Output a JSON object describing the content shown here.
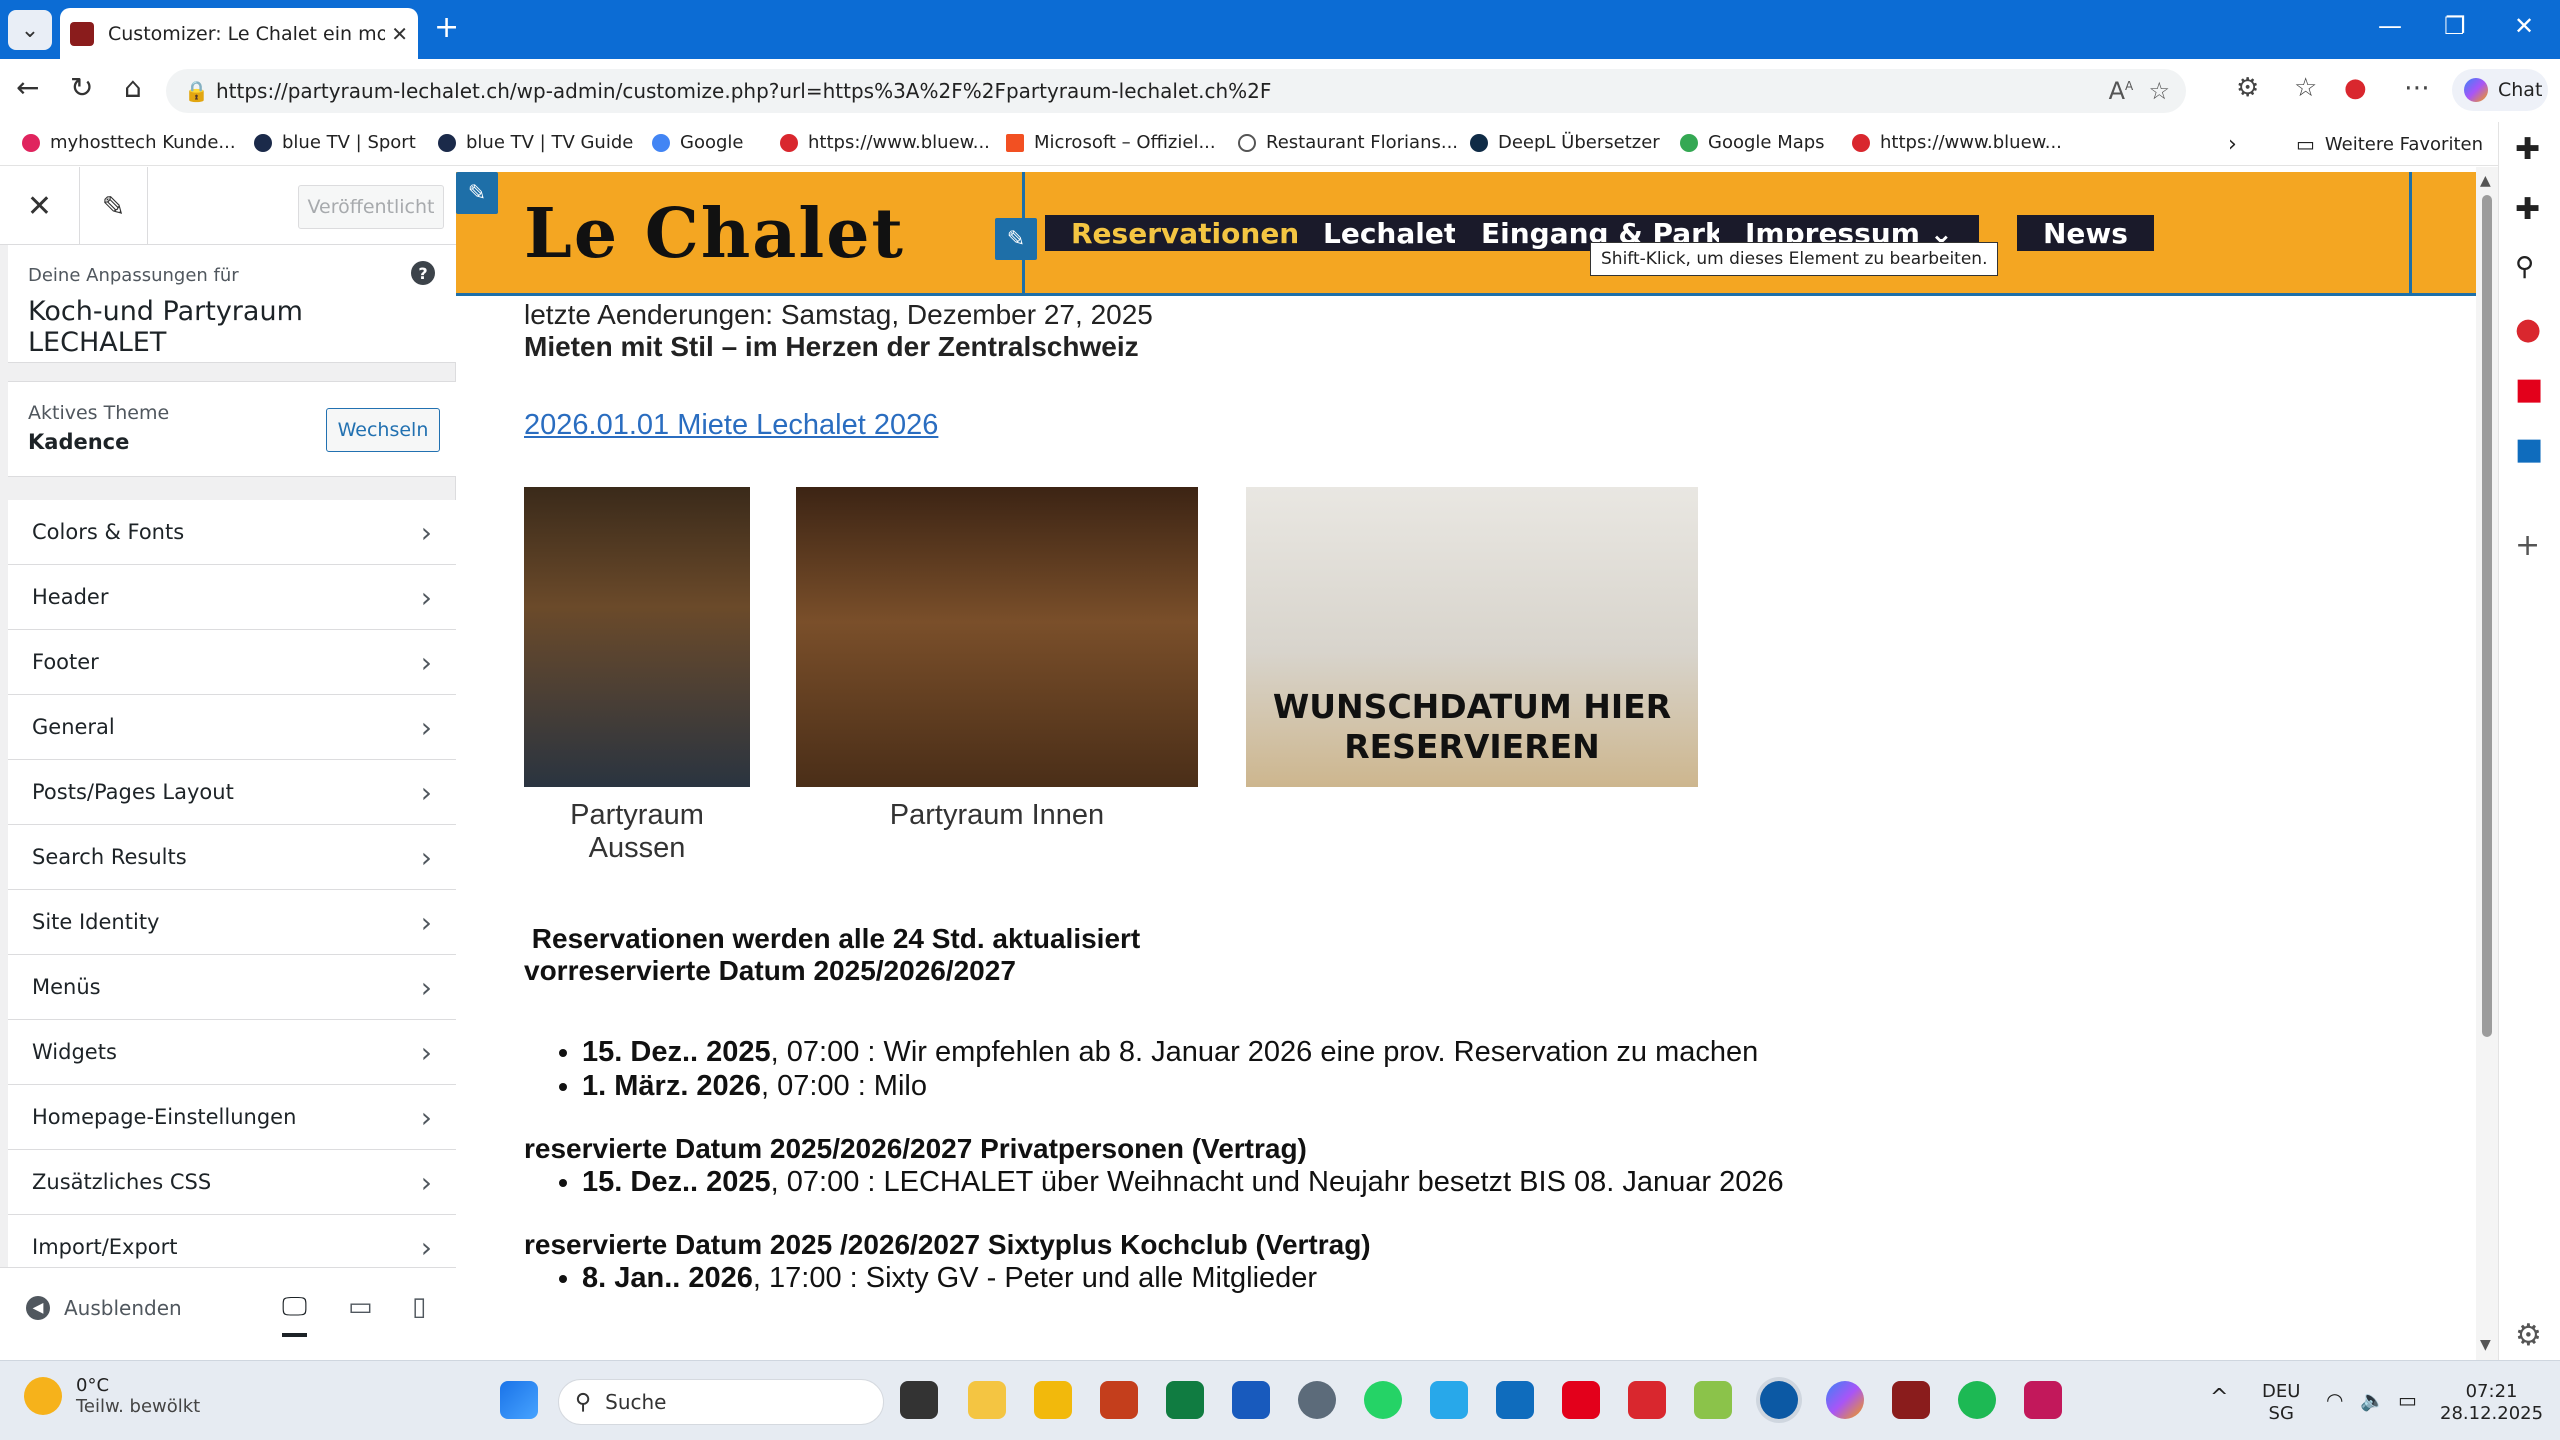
{
  "browser": {
    "tab_title": "Customizer: Le Chalet ein moderne",
    "url": "https://partyraum-lechalet.ch/wp-admin/customize.php?url=https%3A%2F%2Fpartyraum-lechalet.ch%2F",
    "chat_label": "Chat",
    "bookmarks": [
      {
        "label": "myhosttech Kunde...",
        "color": "#e0245e"
      },
      {
        "label": "blue TV | Sport",
        "color": "#1b2a4a"
      },
      {
        "label": "blue TV | TV Guide",
        "color": "#1b2a4a"
      },
      {
        "label": "Google",
        "color": "#4285f4"
      },
      {
        "label": "https://www.bluew...",
        "color": "#d9272e"
      },
      {
        "label": "Microsoft – Offiziel...",
        "color": "#f25022"
      },
      {
        "label": "Restaurant Florians...",
        "color": "#555555"
      },
      {
        "label": "DeepL Übersetzer",
        "color": "#0f2b46"
      },
      {
        "label": "Google Maps",
        "color": "#34a853"
      },
      {
        "label": "https://www.bluew...",
        "color": "#d9272e"
      }
    ],
    "more_favorites": "Weitere Favoriten"
  },
  "customizer": {
    "publish_label": "Veröffentlicht",
    "customizing_for": "Deine Anpassungen für",
    "site_name": "Koch-und Partyraum LECHALET",
    "active_theme_label": "Aktives Theme",
    "theme_name": "Kadence",
    "switch_label": "Wechseln",
    "menu": [
      "Colors & Fonts",
      "Header",
      "Footer",
      "General",
      "Posts/Pages Layout",
      "Search Results",
      "Site Identity",
      "Menüs",
      "Widgets",
      "Homepage-Einstellungen",
      "Zusätzliches CSS",
      "Import/Export"
    ],
    "hide_label": "Ausblenden"
  },
  "site": {
    "logo": "Le Chalet",
    "nav": [
      {
        "label": "Reservationen",
        "caret": ""
      },
      {
        "label": "Lechalet",
        "caret": "⌄"
      },
      {
        "label": "Eingang & Parking",
        "caret": ""
      },
      {
        "label": "Impressum",
        "caret": "⌄"
      },
      {
        "label": "News",
        "caret": ""
      }
    ],
    "tooltip": "Shift-Klick, um dieses Element zu bearbeiten.",
    "updated": "letzte Aenderungen: Samstag, Dezember 27, 2025",
    "tagline": "Mieten mit Stil – im Herzen der Zentralschweiz",
    "link": "2026.01.01 Miete Lechalet 2026",
    "images": [
      {
        "caption": "Partyraum Aussen"
      },
      {
        "caption": "Partyraum Innen"
      },
      {
        "caption": "",
        "overlay": "WUNSCHDATUM HIER RESERVIEREN"
      }
    ],
    "heading1": " Reservationen werden alle 24 Std. aktualisiert",
    "heading1b": "vorreservierte Datum 2025/2026/2027",
    "list1": [
      {
        "bold": "15. Dez.. 2025",
        "text": ", 07:00 : Wir empfehlen ab 8. Januar 2026 eine prov. Reservation zu machen"
      },
      {
        "bold": "1. März. 2026",
        "text": ", 07:00 : Milo"
      }
    ],
    "heading2": "reservierte Datum 2025/2026/2027 Privatpersonen (Vertrag)",
    "list2": [
      {
        "bold": "15. Dez.. 2025",
        "text": ", 07:00 : LECHALET über Weihnacht und Neujahr besetzt BIS 08. Januar 2026"
      }
    ],
    "heading3": "reservierte Datum 2025 /2026/2027 Sixtyplus Kochclub (Vertrag)",
    "list3": [
      {
        "bold": "8. Jan.. 2026",
        "text": ", 17:00 : Sixty GV - Peter und alle Mitglieder"
      }
    ]
  },
  "taskbar": {
    "temp": "0°C",
    "weather": "Teilw. bewölkt",
    "search_placeholder": "Suche",
    "lang1": "DEU",
    "lang2": "SG",
    "time": "07:21",
    "date": "28.12.2025"
  }
}
